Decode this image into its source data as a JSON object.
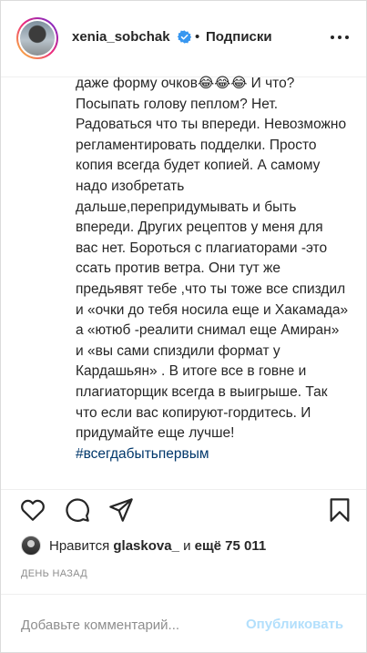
{
  "header": {
    "username": "xenia_sobchak",
    "separator": "•",
    "follow_label": "Подписки",
    "verified_icon": "verified-badge-icon",
    "more_icon": "more-options-icon"
  },
  "caption": {
    "text": "даже форму очков😂😂😂 И что? Посыпать голову пеплом? Нет. Радоваться что ты впереди. Невозможно регламентировать подделки. Просто копия всегда будет копией. А самому надо изобретать дальше,перепридумывать и быть впереди. Других рецептов у меня для вас нет. Бороться с плагиаторами -это ссать против ветра. Они тут же предьявят тебе ,что ты тоже все спиздил и «очки до тебя носила еще и Хакамада» а «ютюб -реалити снимал еще Амиран» и «вы сами спиздили формат у Кардашьян» . В итоге все в говне и плагиаторщик всегда в выигрыше. Так что если вас копируют-гордитесь. И придумайте еще лучше! ",
    "hashtag": "#всегдабытьпервым"
  },
  "actions": {
    "like_icon": "heart-icon",
    "comment_icon": "comment-bubble-icon",
    "share_icon": "share-paper-plane-icon",
    "save_icon": "bookmark-icon"
  },
  "likes": {
    "prefix": "Нравится ",
    "user": "glaskova_",
    "middle": " и ",
    "others": "ещё 75 011"
  },
  "timestamp": "День назад",
  "comment_box": {
    "placeholder": "Добавьте комментарий...",
    "publish_label": "Опубликовать"
  },
  "colors": {
    "text": "#262626",
    "secondary": "#8e8e8e",
    "hashtag": "#00376b",
    "verified": "#3897f0",
    "publish_disabled": "#b2dffc"
  }
}
